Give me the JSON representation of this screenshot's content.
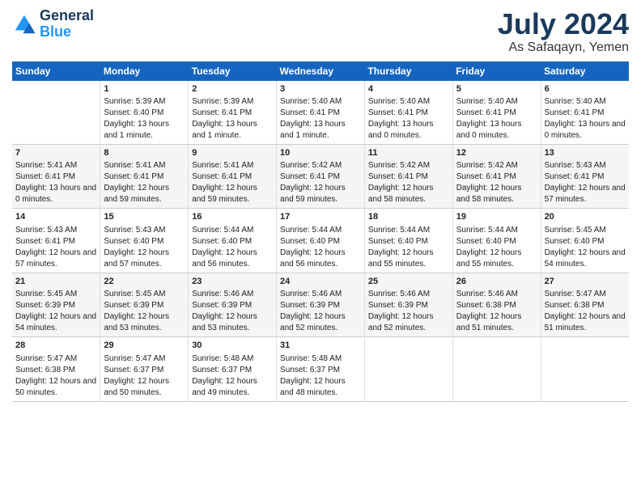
{
  "header": {
    "logo_line1": "General",
    "logo_line2": "Blue",
    "title": "July 2024",
    "subtitle": "As Safaqayn, Yemen"
  },
  "columns": [
    "Sunday",
    "Monday",
    "Tuesday",
    "Wednesday",
    "Thursday",
    "Friday",
    "Saturday"
  ],
  "weeks": [
    [
      {
        "day": "",
        "sunrise": "",
        "sunset": "",
        "daylight": ""
      },
      {
        "day": "1",
        "sunrise": "Sunrise: 5:39 AM",
        "sunset": "Sunset: 6:40 PM",
        "daylight": "Daylight: 13 hours and 1 minute."
      },
      {
        "day": "2",
        "sunrise": "Sunrise: 5:39 AM",
        "sunset": "Sunset: 6:41 PM",
        "daylight": "Daylight: 13 hours and 1 minute."
      },
      {
        "day": "3",
        "sunrise": "Sunrise: 5:40 AM",
        "sunset": "Sunset: 6:41 PM",
        "daylight": "Daylight: 13 hours and 1 minute."
      },
      {
        "day": "4",
        "sunrise": "Sunrise: 5:40 AM",
        "sunset": "Sunset: 6:41 PM",
        "daylight": "Daylight: 13 hours and 0 minutes."
      },
      {
        "day": "5",
        "sunrise": "Sunrise: 5:40 AM",
        "sunset": "Sunset: 6:41 PM",
        "daylight": "Daylight: 13 hours and 0 minutes."
      },
      {
        "day": "6",
        "sunrise": "Sunrise: 5:40 AM",
        "sunset": "Sunset: 6:41 PM",
        "daylight": "Daylight: 13 hours and 0 minutes."
      }
    ],
    [
      {
        "day": "7",
        "sunrise": "Sunrise: 5:41 AM",
        "sunset": "Sunset: 6:41 PM",
        "daylight": "Daylight: 13 hours and 0 minutes."
      },
      {
        "day": "8",
        "sunrise": "Sunrise: 5:41 AM",
        "sunset": "Sunset: 6:41 PM",
        "daylight": "Daylight: 12 hours and 59 minutes."
      },
      {
        "day": "9",
        "sunrise": "Sunrise: 5:41 AM",
        "sunset": "Sunset: 6:41 PM",
        "daylight": "Daylight: 12 hours and 59 minutes."
      },
      {
        "day": "10",
        "sunrise": "Sunrise: 5:42 AM",
        "sunset": "Sunset: 6:41 PM",
        "daylight": "Daylight: 12 hours and 59 minutes."
      },
      {
        "day": "11",
        "sunrise": "Sunrise: 5:42 AM",
        "sunset": "Sunset: 6:41 PM",
        "daylight": "Daylight: 12 hours and 58 minutes."
      },
      {
        "day": "12",
        "sunrise": "Sunrise: 5:42 AM",
        "sunset": "Sunset: 6:41 PM",
        "daylight": "Daylight: 12 hours and 58 minutes."
      },
      {
        "day": "13",
        "sunrise": "Sunrise: 5:43 AM",
        "sunset": "Sunset: 6:41 PM",
        "daylight": "Daylight: 12 hours and 57 minutes."
      }
    ],
    [
      {
        "day": "14",
        "sunrise": "Sunrise: 5:43 AM",
        "sunset": "Sunset: 6:41 PM",
        "daylight": "Daylight: 12 hours and 57 minutes."
      },
      {
        "day": "15",
        "sunrise": "Sunrise: 5:43 AM",
        "sunset": "Sunset: 6:40 PM",
        "daylight": "Daylight: 12 hours and 57 minutes."
      },
      {
        "day": "16",
        "sunrise": "Sunrise: 5:44 AM",
        "sunset": "Sunset: 6:40 PM",
        "daylight": "Daylight: 12 hours and 56 minutes."
      },
      {
        "day": "17",
        "sunrise": "Sunrise: 5:44 AM",
        "sunset": "Sunset: 6:40 PM",
        "daylight": "Daylight: 12 hours and 56 minutes."
      },
      {
        "day": "18",
        "sunrise": "Sunrise: 5:44 AM",
        "sunset": "Sunset: 6:40 PM",
        "daylight": "Daylight: 12 hours and 55 minutes."
      },
      {
        "day": "19",
        "sunrise": "Sunrise: 5:44 AM",
        "sunset": "Sunset: 6:40 PM",
        "daylight": "Daylight: 12 hours and 55 minutes."
      },
      {
        "day": "20",
        "sunrise": "Sunrise: 5:45 AM",
        "sunset": "Sunset: 6:40 PM",
        "daylight": "Daylight: 12 hours and 54 minutes."
      }
    ],
    [
      {
        "day": "21",
        "sunrise": "Sunrise: 5:45 AM",
        "sunset": "Sunset: 6:39 PM",
        "daylight": "Daylight: 12 hours and 54 minutes."
      },
      {
        "day": "22",
        "sunrise": "Sunrise: 5:45 AM",
        "sunset": "Sunset: 6:39 PM",
        "daylight": "Daylight: 12 hours and 53 minutes."
      },
      {
        "day": "23",
        "sunrise": "Sunrise: 5:46 AM",
        "sunset": "Sunset: 6:39 PM",
        "daylight": "Daylight: 12 hours and 53 minutes."
      },
      {
        "day": "24",
        "sunrise": "Sunrise: 5:46 AM",
        "sunset": "Sunset: 6:39 PM",
        "daylight": "Daylight: 12 hours and 52 minutes."
      },
      {
        "day": "25",
        "sunrise": "Sunrise: 5:46 AM",
        "sunset": "Sunset: 6:39 PM",
        "daylight": "Daylight: 12 hours and 52 minutes."
      },
      {
        "day": "26",
        "sunrise": "Sunrise: 5:46 AM",
        "sunset": "Sunset: 6:38 PM",
        "daylight": "Daylight: 12 hours and 51 minutes."
      },
      {
        "day": "27",
        "sunrise": "Sunrise: 5:47 AM",
        "sunset": "Sunset: 6:38 PM",
        "daylight": "Daylight: 12 hours and 51 minutes."
      }
    ],
    [
      {
        "day": "28",
        "sunrise": "Sunrise: 5:47 AM",
        "sunset": "Sunset: 6:38 PM",
        "daylight": "Daylight: 12 hours and 50 minutes."
      },
      {
        "day": "29",
        "sunrise": "Sunrise: 5:47 AM",
        "sunset": "Sunset: 6:37 PM",
        "daylight": "Daylight: 12 hours and 50 minutes."
      },
      {
        "day": "30",
        "sunrise": "Sunrise: 5:48 AM",
        "sunset": "Sunset: 6:37 PM",
        "daylight": "Daylight: 12 hours and 49 minutes."
      },
      {
        "day": "31",
        "sunrise": "Sunrise: 5:48 AM",
        "sunset": "Sunset: 6:37 PM",
        "daylight": "Daylight: 12 hours and 48 minutes."
      },
      {
        "day": "",
        "sunrise": "",
        "sunset": "",
        "daylight": ""
      },
      {
        "day": "",
        "sunrise": "",
        "sunset": "",
        "daylight": ""
      },
      {
        "day": "",
        "sunrise": "",
        "sunset": "",
        "daylight": ""
      }
    ]
  ]
}
